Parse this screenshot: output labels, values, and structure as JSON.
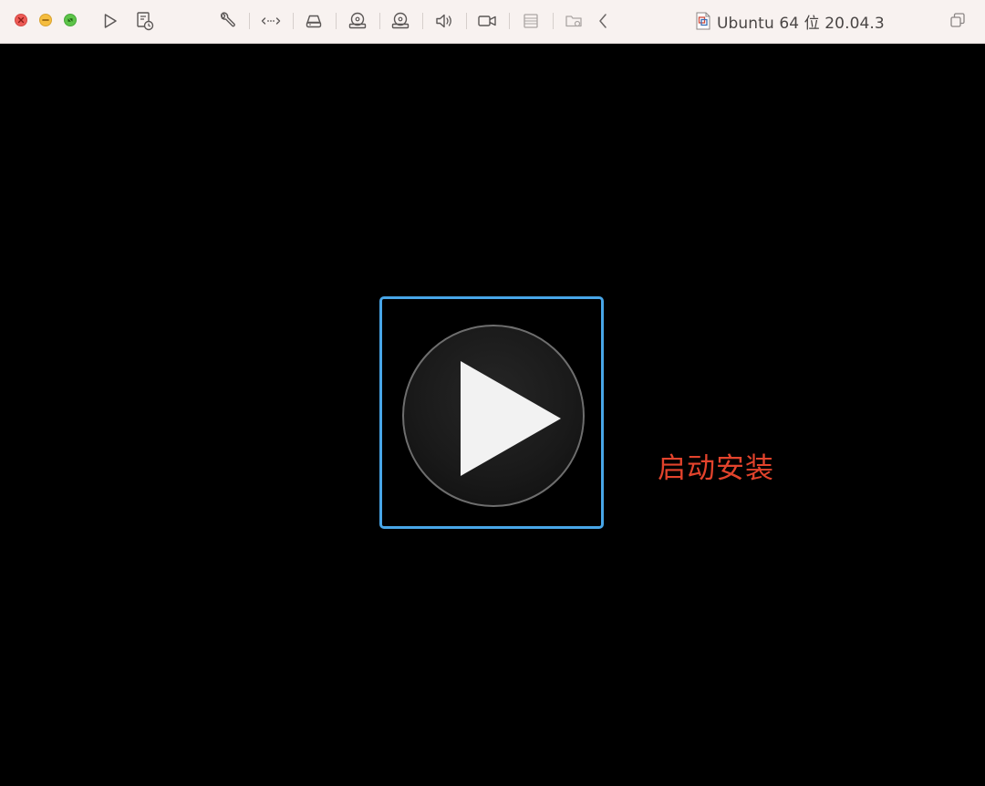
{
  "window": {
    "title": "Ubuntu 64 位 20.04.3"
  },
  "toolbar": {
    "buttons": [
      {
        "name": "play-icon"
      },
      {
        "name": "snapshot-icon"
      },
      {
        "name": "wrench-icon"
      },
      {
        "name": "network-arrows-icon"
      },
      {
        "name": "hard-disk-icon"
      },
      {
        "name": "cd-drive-icon"
      },
      {
        "name": "cd-drive-2-icon"
      },
      {
        "name": "speaker-icon"
      },
      {
        "name": "camera-icon"
      },
      {
        "name": "printer-icon"
      },
      {
        "name": "shared-folder-icon"
      },
      {
        "name": "chevron-left-icon"
      }
    ]
  },
  "screen": {
    "annotation": "启动安装"
  },
  "colors": {
    "titlebar_bg": "#f8f2f0",
    "screen_bg": "#000000",
    "play_frame_border": "#48a6e8",
    "annotation_text": "#e2432c",
    "close": "#ee5b56",
    "minimize": "#f5bd3f",
    "zoom": "#5ec449"
  }
}
